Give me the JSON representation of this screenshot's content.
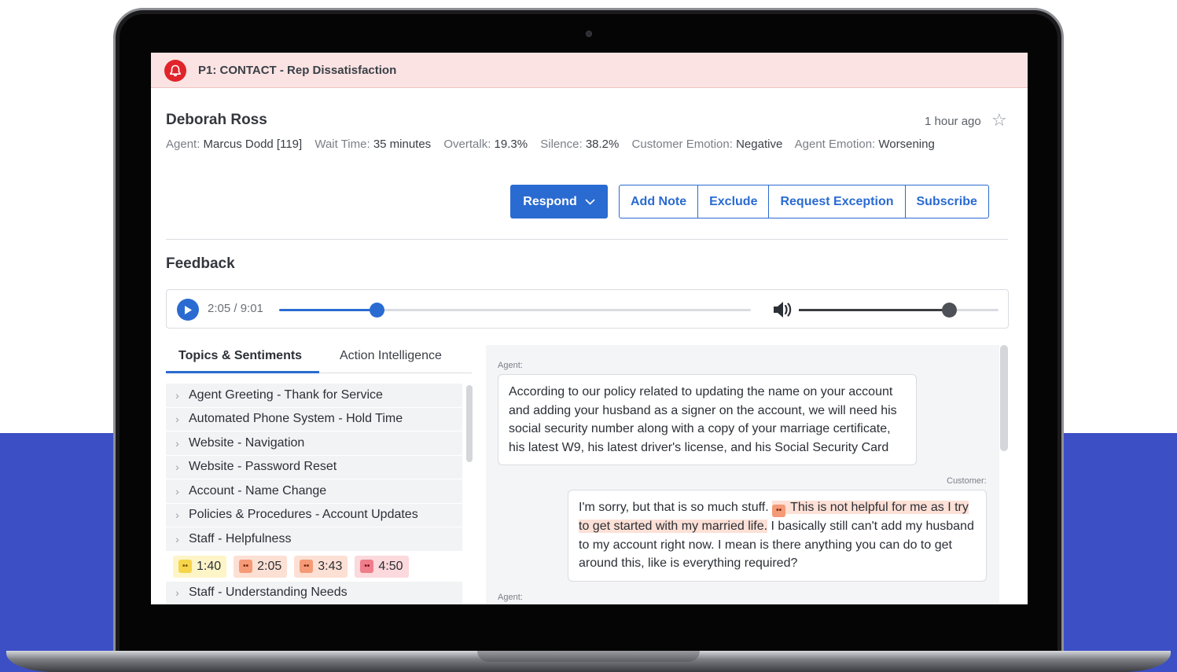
{
  "alert": {
    "title": "P1: CONTACT - Rep Dissatisfaction",
    "icon": "bell-icon",
    "color": "#e0242a"
  },
  "customer": {
    "name": "Deborah Ross",
    "time_ago": "1 hour ago"
  },
  "meta": [
    {
      "label": "Agent:",
      "value": "Marcus Dodd [119]"
    },
    {
      "label": "Wait Time:",
      "value": "35 minutes"
    },
    {
      "label": "Overtalk:",
      "value": "19.3%"
    },
    {
      "label": "Silence:",
      "value": "38.2%"
    },
    {
      "label": "Customer Emotion:",
      "value": "Negative"
    },
    {
      "label": "Agent Emotion:",
      "value": "Worsening"
    }
  ],
  "actions": {
    "respond": "Respond",
    "add_note": "Add Note",
    "exclude": "Exclude",
    "request_exception": "Request Exception",
    "subscribe": "Subscribe"
  },
  "feedback": {
    "title": "Feedback",
    "player": {
      "time": "2:05 / 9:01",
      "progress": 0.206,
      "volume": 0.75
    }
  },
  "tabs": [
    {
      "label": "Topics & Sentiments",
      "active": true
    },
    {
      "label": "Action Intelligence",
      "active": false
    }
  ],
  "topics": [
    "Agent Greeting - Thank for Service",
    "Automated Phone System - Hold Time",
    "Website - Navigation",
    "Website - Password Reset",
    "Account - Name Change",
    "Policies & Procedures - Account Updates",
    "Staff - Helpfulness",
    "Staff - Understanding Needs"
  ],
  "sentiment_chips": [
    {
      "time": "1:40",
      "level": "yellow"
    },
    {
      "time": "2:05",
      "level": "orange"
    },
    {
      "time": "3:43",
      "level": "orange"
    },
    {
      "time": "4:50",
      "level": "red"
    }
  ],
  "transcript": {
    "agent_label": "Agent:",
    "customer_label": "Customer:",
    "agent_text": "According to our policy related to updating the name on your account and adding your husband as a signer on the account, we will need his social security number along with a copy of your marriage certificate, his latest W9, his latest driver's license, and his Social Security Card",
    "customer_text_before": "I'm sorry, but that is so much stuff. ",
    "customer_text_highlight": "This is not helpful for me as I try to get started with my married life.",
    "customer_text_after": " I basically still can't add my husband to my account right now. I mean is there anything you can do to get around this, like is everything required?"
  }
}
